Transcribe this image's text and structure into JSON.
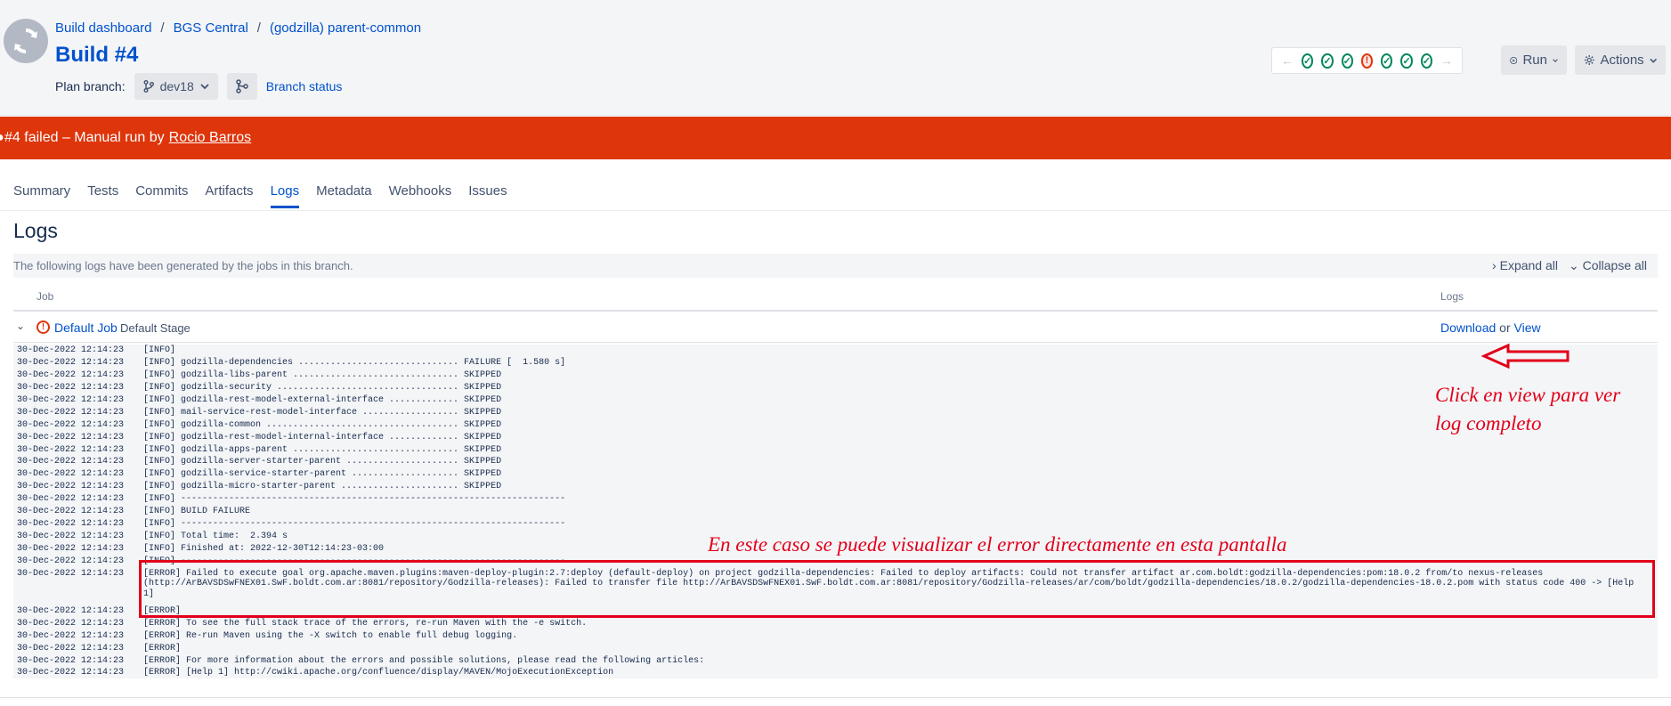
{
  "breadcrumb": {
    "items": [
      "Build dashboard",
      "BGS Central",
      "(godzilla) parent-common"
    ],
    "separator": "/"
  },
  "build": {
    "title": "Build #4",
    "branch_label": "Plan branch:",
    "branch_value": "dev18",
    "branch_status_link": "Branch status"
  },
  "history": {
    "statuses": [
      "ok",
      "ok",
      "ok",
      "fail",
      "ok",
      "ok",
      "ok"
    ]
  },
  "toolbar": {
    "run_label": "Run",
    "actions_label": "Actions"
  },
  "banner": {
    "text": "#4 failed – Manual run by",
    "user": "Rocio Barros",
    "color": "#de350b"
  },
  "tabs": [
    "Summary",
    "Tests",
    "Commits",
    "Artifacts",
    "Logs",
    "Metadata",
    "Webhooks",
    "Issues"
  ],
  "active_tab": "Logs",
  "page": {
    "title": "Logs",
    "description": "The following logs have been generated by the jobs in this branch.",
    "expand_all": "Expand all",
    "collapse_all": "Collapse all"
  },
  "table": {
    "col_job": "Job",
    "col_logs": "Logs"
  },
  "job": {
    "name": "Default Job",
    "stage": "Default Stage",
    "download": "Download",
    "or": "or",
    "view": "View"
  },
  "log": [
    {
      "ts": "30-Dec-2022 12:14:23",
      "msg": "[INFO]"
    },
    {
      "ts": "30-Dec-2022 12:14:23",
      "msg": "[INFO] godzilla-dependencies .............................. FAILURE [  1.580 s]"
    },
    {
      "ts": "30-Dec-2022 12:14:23",
      "msg": "[INFO] godzilla-libs-parent ............................... SKIPPED"
    },
    {
      "ts": "30-Dec-2022 12:14:23",
      "msg": "[INFO] godzilla-security .................................. SKIPPED"
    },
    {
      "ts": "30-Dec-2022 12:14:23",
      "msg": "[INFO] godzilla-rest-model-external-interface ............. SKIPPED"
    },
    {
      "ts": "30-Dec-2022 12:14:23",
      "msg": "[INFO] mail-service-rest-model-interface .................. SKIPPED"
    },
    {
      "ts": "30-Dec-2022 12:14:23",
      "msg": "[INFO] godzilla-common .................................... SKIPPED"
    },
    {
      "ts": "30-Dec-2022 12:14:23",
      "msg": "[INFO] godzilla-rest-model-internal-interface ............. SKIPPED"
    },
    {
      "ts": "30-Dec-2022 12:14:23",
      "msg": "[INFO] godzilla-apps-parent ............................... SKIPPED"
    },
    {
      "ts": "30-Dec-2022 12:14:23",
      "msg": "[INFO] godzilla-server-starter-parent ..................... SKIPPED"
    },
    {
      "ts": "30-Dec-2022 12:14:23",
      "msg": "[INFO] godzilla-service-starter-parent .................... SKIPPED"
    },
    {
      "ts": "30-Dec-2022 12:14:23",
      "msg": "[INFO] godzilla-micro-starter-parent ...................... SKIPPED"
    },
    {
      "ts": "30-Dec-2022 12:14:23",
      "msg": "[INFO] ------------------------------------------------------------------------"
    },
    {
      "ts": "30-Dec-2022 12:14:23",
      "msg": "[INFO] BUILD FAILURE"
    },
    {
      "ts": "30-Dec-2022 12:14:23",
      "msg": "[INFO] ------------------------------------------------------------------------"
    },
    {
      "ts": "30-Dec-2022 12:14:23",
      "msg": "[INFO] Total time:  2.394 s"
    },
    {
      "ts": "30-Dec-2022 12:14:23",
      "msg": "[INFO] Finished at: 2022-12-30T12:14:23-03:00"
    },
    {
      "ts": "30-Dec-2022 12:14:23",
      "msg": "[INFO] ------------------------------------------------------------------------"
    },
    {
      "ts": "30-Dec-2022 12:14:23",
      "msg": "[ERROR] Failed to execute goal org.apache.maven.plugins:maven-deploy-plugin:2.7:deploy (default-deploy) on project godzilla-dependencies: Failed to deploy artifacts: Could not transfer artifact ar.com.boldt:godzilla-dependencies:pom:18.0.2 from/to nexus-releases (http://ArBAVSDSwFNEX01.SwF.boldt.com.ar:8081/repository/Godzilla-releases): Failed to transfer file http://ArBAVSDSwFNEX01.SwF.boldt.com.ar:8081/repository/Godzilla-releases/ar/com/boldt/godzilla-dependencies/18.0.2/godzilla-dependencies-18.0.2.pom with status code 400 -> [Help 1]",
      "multi": true
    },
    {
      "ts": "30-Dec-2022 12:14:23",
      "msg": "[ERROR]"
    },
    {
      "ts": "30-Dec-2022 12:14:23",
      "msg": "[ERROR] To see the full stack trace of the errors, re-run Maven with the -e switch."
    },
    {
      "ts": "30-Dec-2022 12:14:23",
      "msg": "[ERROR] Re-run Maven using the -X switch to enable full debug logging."
    },
    {
      "ts": "30-Dec-2022 12:14:23",
      "msg": "[ERROR]"
    },
    {
      "ts": "30-Dec-2022 12:14:23",
      "msg": "[ERROR] For more information about the errors and possible solutions, please read the following articles:"
    },
    {
      "ts": "30-Dec-2022 12:14:23",
      "msg": "[ERROR] [Help 1] http://cwiki.apache.org/confluence/display/MAVEN/MojoExecutionException"
    }
  ],
  "annotations": {
    "click_view": "Click en view para ver log completo",
    "error_note": "En este caso se puede visualizar el error directamente en esta pantalla",
    "color": "#e2001a"
  }
}
